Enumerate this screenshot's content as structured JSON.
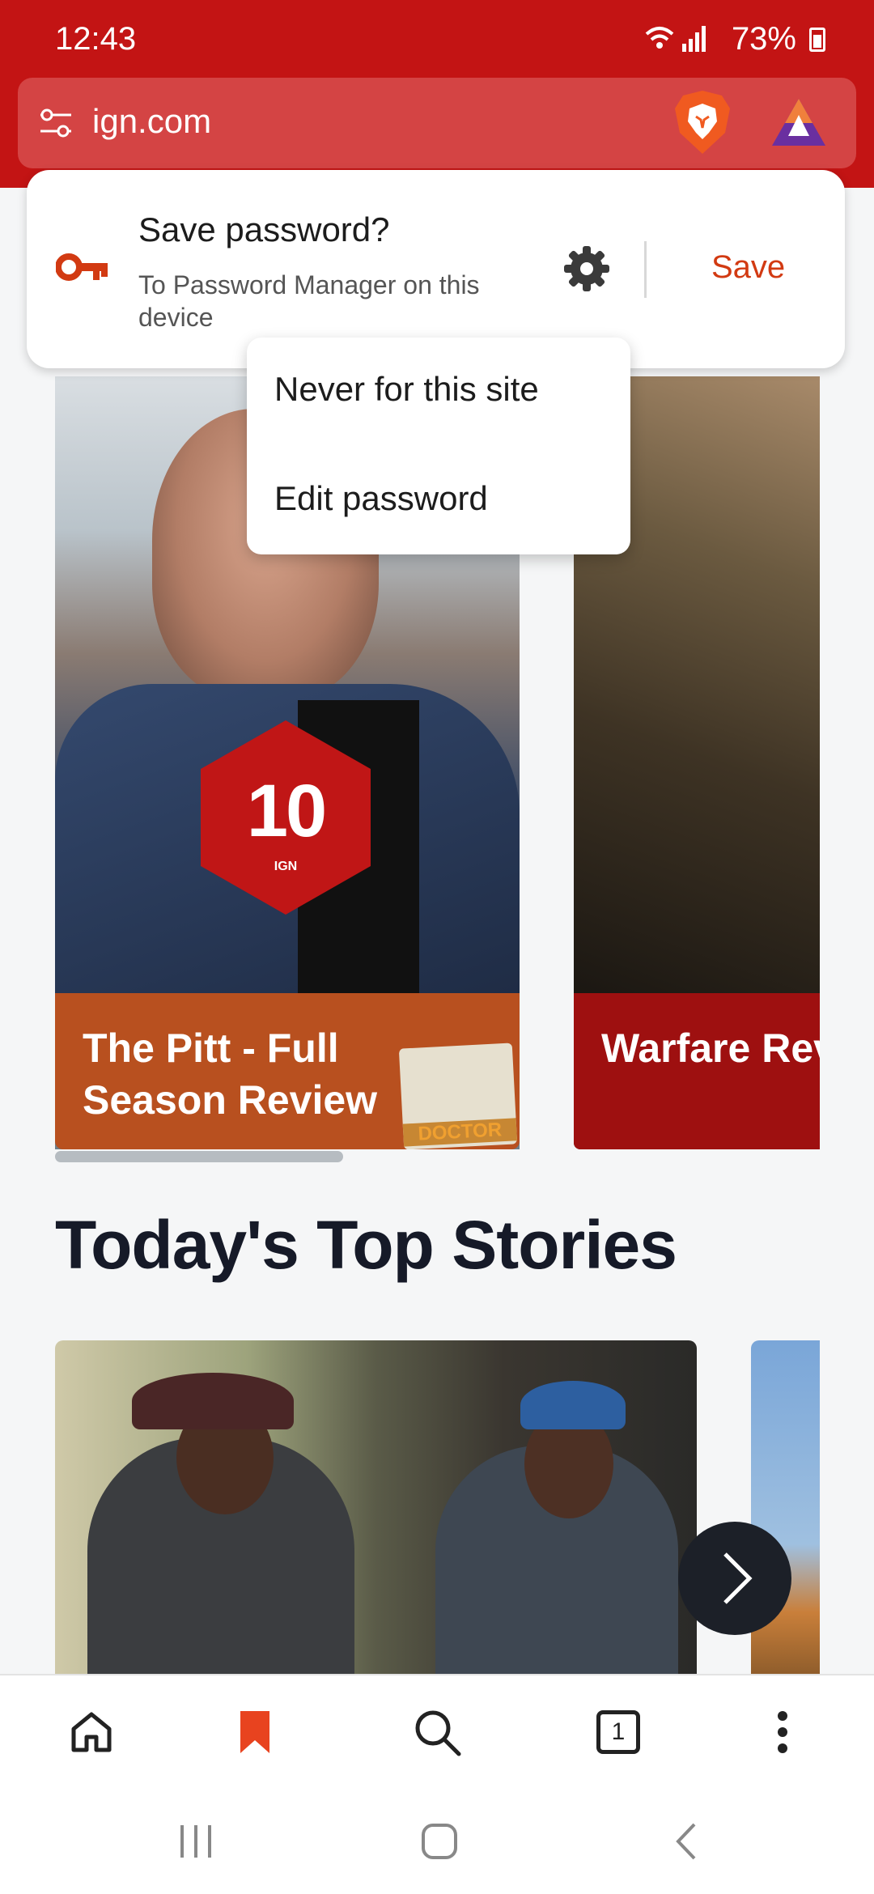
{
  "status_bar": {
    "time": "12:43",
    "battery": "73%",
    "icons": [
      "wifi-icon",
      "signal-icon",
      "battery-icon"
    ]
  },
  "url_bar": {
    "url": "ign.com",
    "icons": [
      "site-settings-icon",
      "brave-shields-icon",
      "brave-rewards-icon"
    ]
  },
  "save_password_dialog": {
    "title": "Save password?",
    "subtitle": "To Password Manager on this device",
    "save_label": "Save",
    "icons": [
      "key-icon",
      "gear-icon"
    ],
    "accent_color": "#d23a12"
  },
  "overflow_menu": {
    "items": [
      {
        "label": "Never for this site"
      },
      {
        "label": "Edit password"
      }
    ]
  },
  "carousel": {
    "cards": [
      {
        "title": "The Pitt - Full Season Review",
        "score": "10",
        "score_brand": "IGN",
        "badge_text": "DOCTOR",
        "band_color": "#b8501f"
      },
      {
        "title": "Warfare Review (Now in Theaters)",
        "band_color": "#9e1010"
      }
    ]
  },
  "top_stories": {
    "heading": "Today's Top Stories"
  },
  "bottom_toolbar": {
    "tab_count": "1",
    "icons": [
      "home-icon",
      "bookmark-icon",
      "search-icon",
      "tabs-icon",
      "more-icon"
    ],
    "active_color": "#e8431f"
  },
  "system_nav": {
    "icons": [
      "recents-icon",
      "home-circle-icon",
      "back-icon"
    ]
  },
  "brand_color": "#c31414"
}
